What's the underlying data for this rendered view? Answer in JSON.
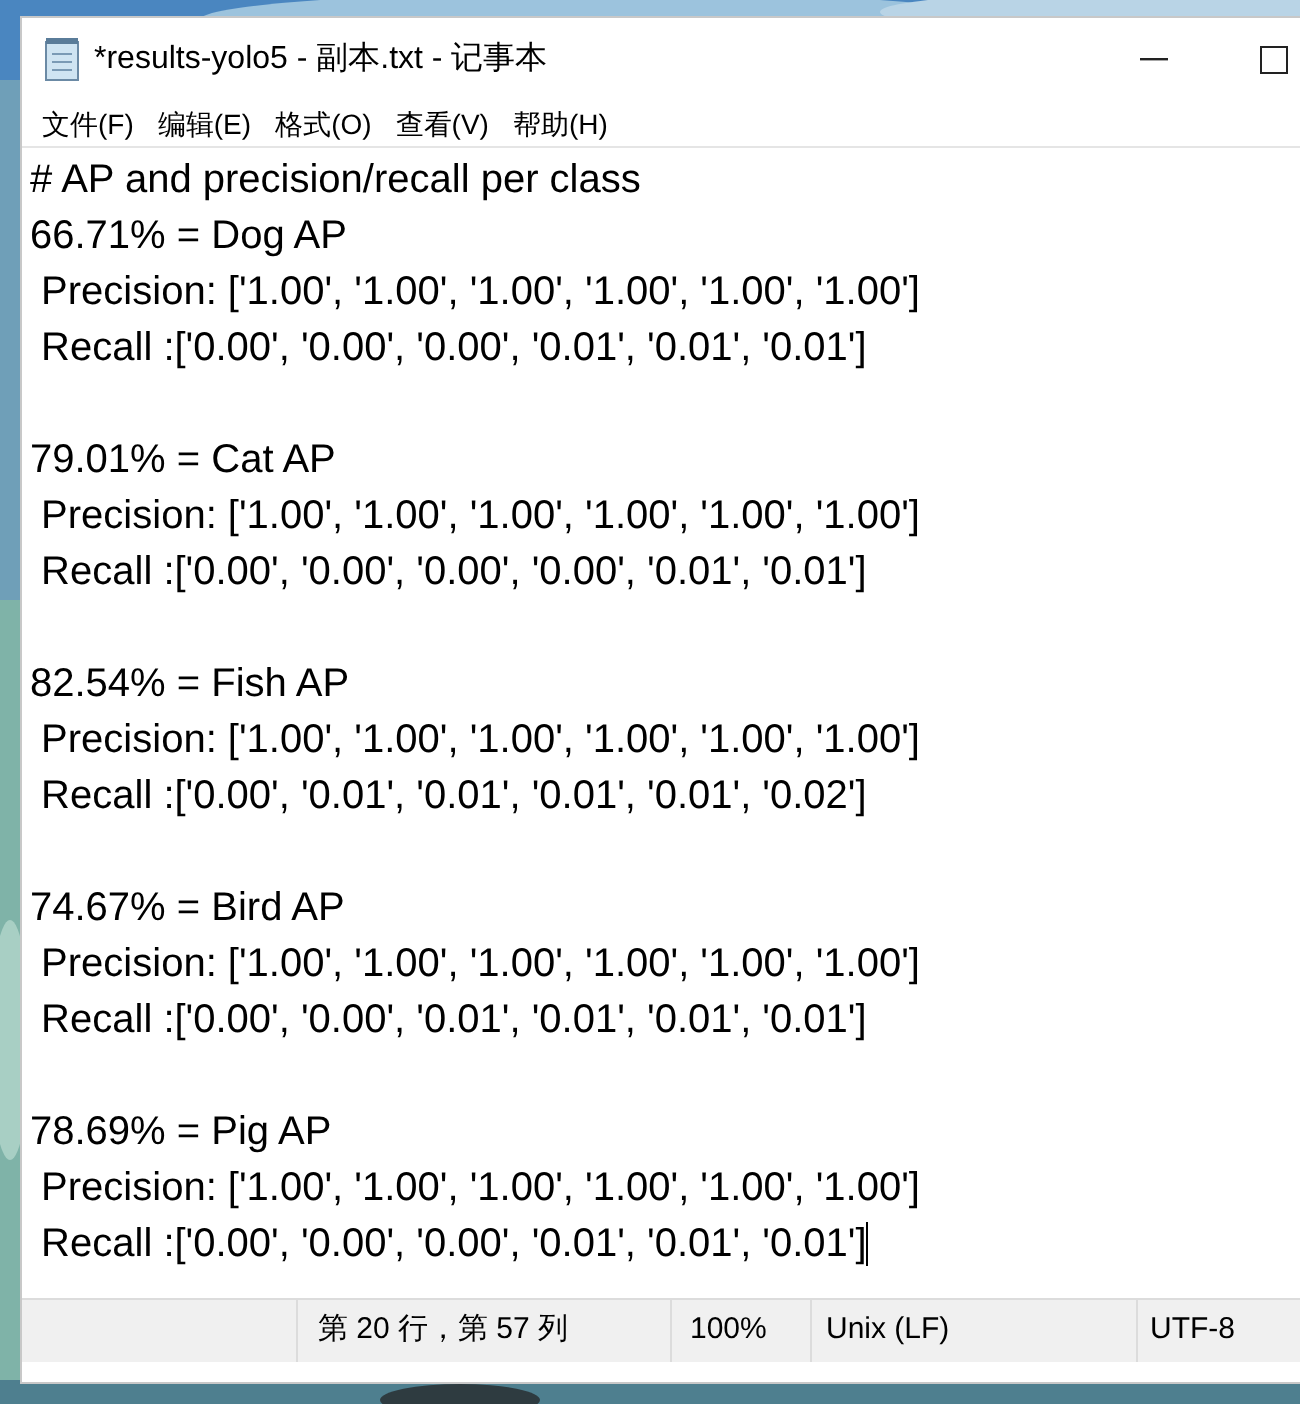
{
  "window": {
    "title": "*results-yolo5 - 副本.txt - 记事本"
  },
  "menu": [
    "文件(F)",
    "编辑(E)",
    "格式(O)",
    "查看(V)",
    "帮助(H)"
  ],
  "editor": {
    "blocks": [
      {
        "lines": [
          "# AP and precision/recall per class",
          "66.71% = Dog AP",
          " Precision: ['1.00', '1.00', '1.00', '1.00', '1.00', '1.00']",
          " Recall :['0.00', '0.00', '0.00', '0.01', '0.01', '0.01']"
        ]
      },
      {
        "lines": [
          "79.01% = Cat AP",
          " Precision: ['1.00', '1.00', '1.00', '1.00', '1.00', '1.00']",
          " Recall :['0.00', '0.00', '0.00', '0.00', '0.01', '0.01']"
        ]
      },
      {
        "lines": [
          "82.54% = Fish AP",
          " Precision: ['1.00', '1.00', '1.00', '1.00', '1.00', '1.00']",
          " Recall :['0.00', '0.01', '0.01', '0.01', '0.01', '0.02']"
        ]
      },
      {
        "lines": [
          "74.67% = Bird AP",
          " Precision: ['1.00', '1.00', '1.00', '1.00', '1.00', '1.00']",
          " Recall :['0.00', '0.00', '0.01', '0.01', '0.01', '0.01']"
        ]
      },
      {
        "lines": [
          "78.69% = Pig AP",
          " Precision: ['1.00', '1.00', '1.00', '1.00', '1.00', '1.00']",
          " Recall :['0.00', '0.00', '0.00', '0.01', '0.01', '0.01']"
        ]
      }
    ]
  },
  "status_bar": {
    "position": "第 20 行，第 57 列",
    "zoom": "100%",
    "line_ending": "Unix (LF)",
    "encoding": "UTF-8"
  }
}
